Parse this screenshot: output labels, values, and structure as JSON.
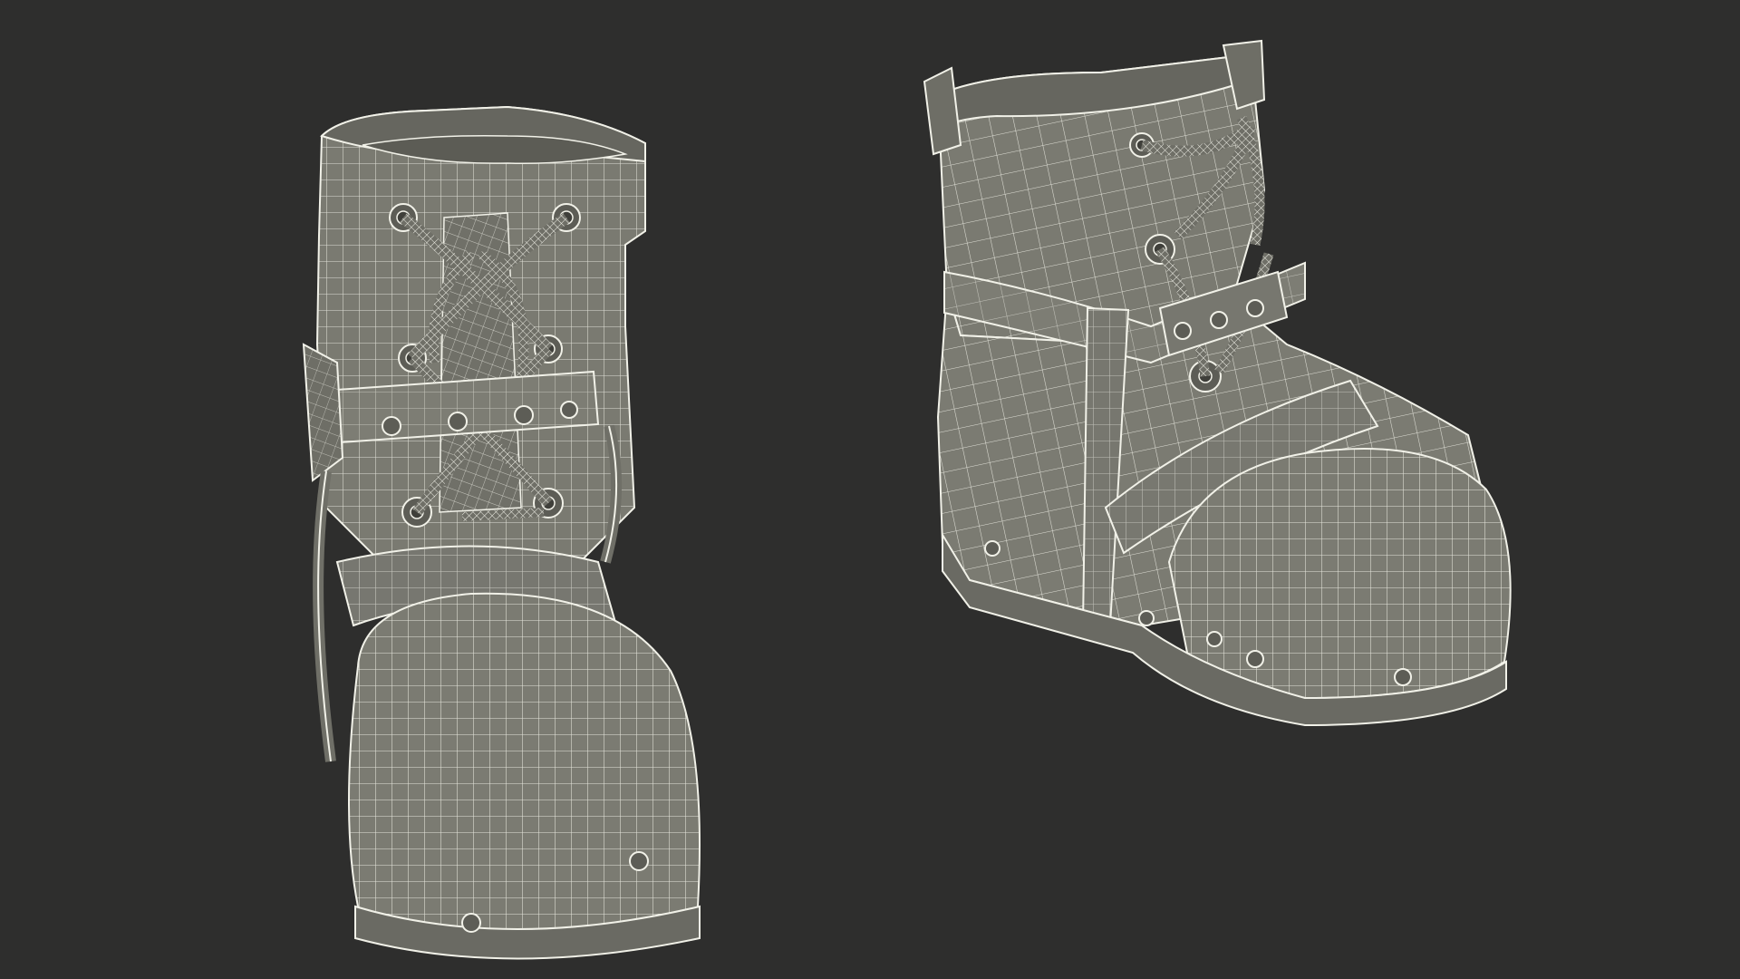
{
  "scene": {
    "subject": "wireframe-boot-pair",
    "colors": {
      "background": "#2e2e2d",
      "surface": "#7b7b72",
      "surface_dark": "#5f5f58",
      "surface_light": "#8f8f86",
      "wire": "#f2f2ea",
      "wire_faint": "#d9d9cf"
    }
  }
}
